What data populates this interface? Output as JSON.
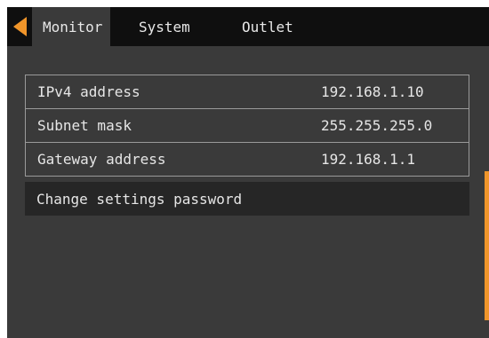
{
  "tabs": [
    {
      "label": "Monitor",
      "active": true
    },
    {
      "label": "System",
      "active": false
    },
    {
      "label": "Outlet",
      "active": false
    }
  ],
  "network": {
    "rows": [
      {
        "label": "IPv4 address",
        "value": "192.168.1.10"
      },
      {
        "label": "Subnet mask",
        "value": "255.255.255.0"
      },
      {
        "label": "Gateway address",
        "value": "192.168.1.1"
      }
    ],
    "change_password_label": "Change settings password"
  },
  "icons": {
    "back": "left-triangle-icon"
  },
  "colors": {
    "accent": "#f0952a",
    "background": "#3a3a3a",
    "tabbar": "#0f0f0f",
    "text": "#e6e6e6"
  }
}
